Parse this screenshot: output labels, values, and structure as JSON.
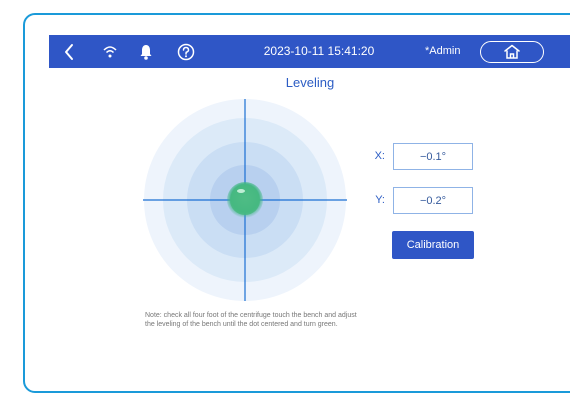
{
  "topbar": {
    "datetime": "2023-10-11 15:41:20",
    "user": "*Admin",
    "icons": [
      "back-icon",
      "wifi-icon",
      "alarm-icon",
      "help-icon",
      "home-icon"
    ]
  },
  "page": {
    "title": "Leveling"
  },
  "leveling": {
    "x_label": "X:",
    "x_value": "−0.1°",
    "y_label": "Y:",
    "y_value": "−0.2°",
    "calibration_label": "Calibration",
    "dot_color": "#43b785"
  },
  "note": {
    "line1": "Note: check all four foot of the centrifuge touch the bench and adjust",
    "line2": "the leveling of the bench until the dot centered and turn green."
  },
  "colors": {
    "accent": "#2f56c6",
    "frame": "#1a9ad9",
    "target_rings": [
      "#eef4fc",
      "#dceaf8",
      "#cadef4",
      "#b8d0ef"
    ]
  }
}
